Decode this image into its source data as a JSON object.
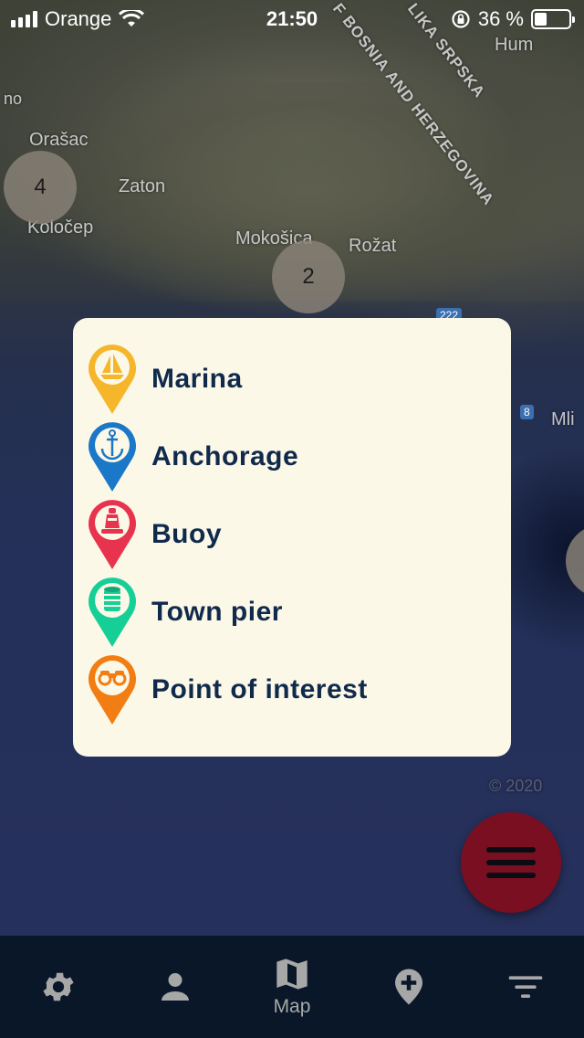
{
  "status_bar": {
    "carrier": "Orange",
    "time": "21:50",
    "battery_percent": "36 %",
    "battery_level": 0.36
  },
  "map": {
    "places": {
      "orasac": "Orašac",
      "zaton": "Zaton",
      "kolocep": "Koločep",
      "mokosica": "Mokošica",
      "rozat": "Rožat",
      "hum": "Hum",
      "mli": "Mli",
      "no": "no",
      "country_bih": "F BOSNIA AND HERZEGOVINA",
      "country_rs": "LIKA SRPSKA",
      "road_222": "222",
      "road_8": "8",
      "copyright": "© 2020"
    },
    "clusters": [
      {
        "count": "4"
      },
      {
        "count": "2"
      }
    ]
  },
  "legend": {
    "items": [
      {
        "label": "Marina",
        "color": "#f5b62b",
        "icon": "sailboat-icon"
      },
      {
        "label": "Anchorage",
        "color": "#1b78c8",
        "icon": "anchor-icon"
      },
      {
        "label": "Buoy",
        "color": "#e8334f",
        "icon": "buoy-icon"
      },
      {
        "label": "Town pier",
        "color": "#16cf96",
        "icon": "pier-icon"
      },
      {
        "label": "Point of interest",
        "color": "#f27d12",
        "icon": "binoculars-icon"
      }
    ]
  },
  "tabs": [
    {
      "icon": "gear-icon",
      "label": ""
    },
    {
      "icon": "person-icon",
      "label": ""
    },
    {
      "icon": "map-icon",
      "label": "Map"
    },
    {
      "icon": "add-location-icon",
      "label": ""
    },
    {
      "icon": "filter-icon",
      "label": ""
    }
  ],
  "colors": {
    "card_background": "#fcf8e8",
    "label_text": "#102a4c",
    "fab_background": "#7a0f22",
    "tabbar_background": "#0a1729"
  }
}
